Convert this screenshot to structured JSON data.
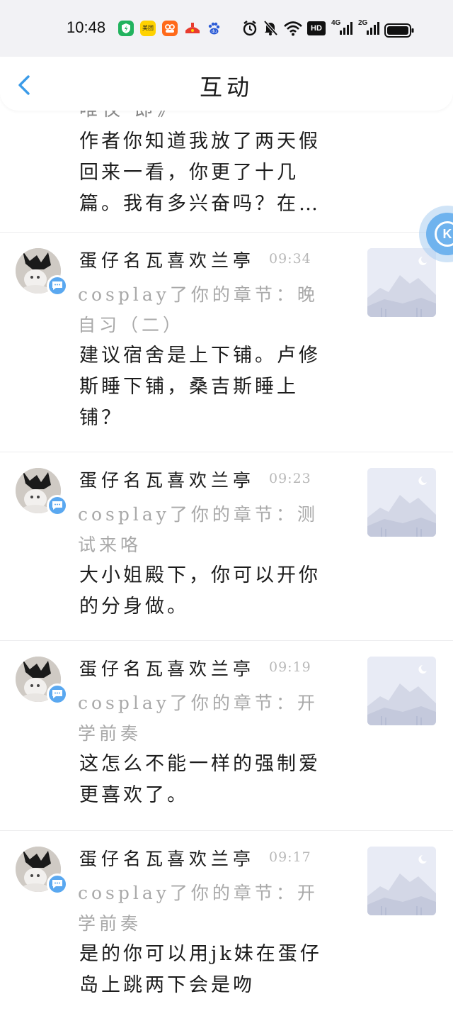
{
  "status_bar": {
    "time": "10:48",
    "apps": [
      {
        "icon": "shield-app-icon",
        "color": "#22b35e",
        "label": ""
      },
      {
        "icon": "meituan-app-icon",
        "color": "#ffd200",
        "label": "美团"
      },
      {
        "icon": "taobao-app-icon",
        "color": "#ff6a1a",
        "label": ""
      },
      {
        "icon": "cart-app-icon",
        "color": "#e83b2e",
        "label": ""
      },
      {
        "icon": "baidu-app-icon",
        "color": "#2b5bd6",
        "label": ""
      }
    ],
    "system_icons": [
      "alarm-icon",
      "mute-icon",
      "wifi-icon",
      "hd-icon",
      "signal-4g-icon",
      "signal-2g-icon",
      "battery-icon"
    ],
    "hd_label": "HD",
    "net1": "4G",
    "net2": "2G"
  },
  "header": {
    "title": "互动",
    "back_icon": "chevron-left-icon"
  },
  "partial_item": {
    "cut_text": "唯仅 即》",
    "comment": "作者你知道我放了两天假回来一看，你更了十几篇。我有多兴奋吗？在…"
  },
  "items": [
    {
      "username": "蛋仔名瓦喜欢兰亭",
      "time": "09:34",
      "action": "cosplay了你的章节：晚自习（二）",
      "comment": "建议宿舍是上下铺。卢修斯睡下铺，桑吉斯睡上铺？"
    },
    {
      "username": "蛋仔名瓦喜欢兰亭",
      "time": "09:23",
      "action": "cosplay了你的章节：测试来咯",
      "comment": "大小姐殿下，你可以开你的分身做。"
    },
    {
      "username": "蛋仔名瓦喜欢兰亭",
      "time": "09:19",
      "action": "cosplay了你的章节：开学前奏",
      "comment": "这怎么不能一样的强制爱更喜欢了。"
    },
    {
      "username": "蛋仔名瓦喜欢兰亭",
      "time": "09:17",
      "action": "cosplay了你的章节：开学前奏",
      "comment": "是的你可以用jk妹在蛋仔岛上跳两下会是吻"
    }
  ],
  "colors": {
    "accent": "#3a9be8",
    "badge": "#5aa8f0",
    "muted_text": "#a9a9a9",
    "divider": "#ececee"
  }
}
